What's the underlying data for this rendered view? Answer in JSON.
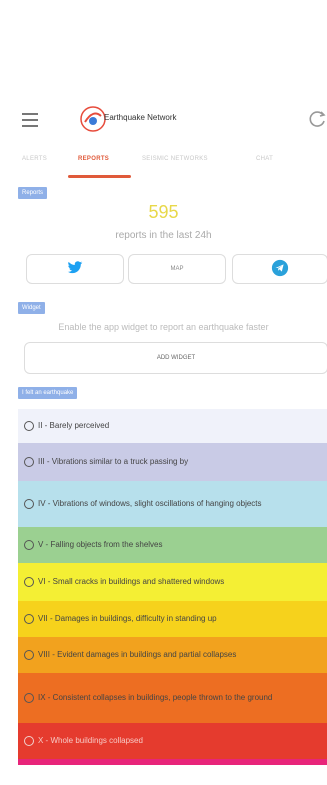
{
  "header": {
    "menu_icon": "menu-icon",
    "title": "Earthquake Network",
    "refresh_icon": "refresh-icon"
  },
  "tabs": [
    {
      "label": "ALERTS",
      "active": false
    },
    {
      "label": "REPORTS",
      "active": true
    },
    {
      "label": "SEISMIC NETWORKS",
      "active": false
    },
    {
      "label": "CHAT",
      "active": false
    }
  ],
  "reports": {
    "section_label": "Reports",
    "count": "595",
    "caption": "reports in the last 24h",
    "share_buttons": [
      {
        "name": "twitter-button",
        "label": "",
        "icon": "twitter-icon",
        "color": "#1da1f2"
      },
      {
        "name": "map-button",
        "label": "MAP",
        "icon": "",
        "color": "#888888"
      },
      {
        "name": "telegram-button",
        "label": "",
        "icon": "telegram-icon",
        "color": "#2aa1da"
      }
    ]
  },
  "widget": {
    "section_label": "Widget",
    "description": "Enable the app widget to report an earthquake faster",
    "button_label": "ADD WIDGET"
  },
  "felt": {
    "section_label": "I felt an earthquake",
    "levels": [
      {
        "label": "II - Barely perceived",
        "color": "#f0f2fa"
      },
      {
        "label": "III - Vibrations similar to a truck passing by",
        "color": "#c9cbe6"
      },
      {
        "label": "IV - Vibrations of windows, slight oscillations of hanging objects",
        "color": "#b7e0ec"
      },
      {
        "label": "V - Falling objects from the shelves",
        "color": "#9bd091"
      },
      {
        "label": "VI - Small cracks in buildings and shattered windows",
        "color": "#f4ef34"
      },
      {
        "label": "VII - Damages in buildings, difficulty in standing up",
        "color": "#f6d21c"
      },
      {
        "label": "VIII - Evident damages in buildings and partial collapses",
        "color": "#f2a21e"
      },
      {
        "label": "IX - Consistent collapses in buildings, people thrown to the ground",
        "color": "#ed6e22"
      },
      {
        "label": "X - Whole buildings collapsed",
        "color": "#e53b2e"
      }
    ]
  }
}
